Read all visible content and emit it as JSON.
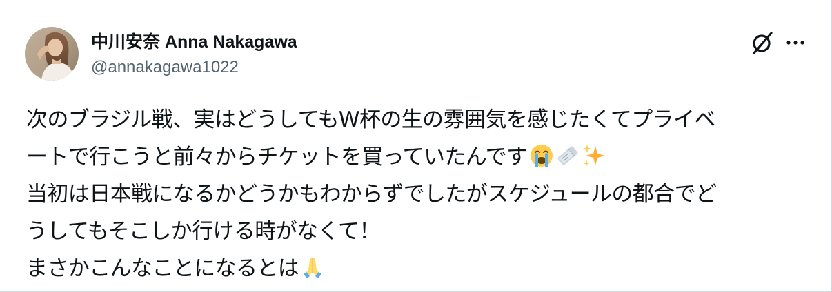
{
  "author": {
    "display_name": "中川安奈 Anna Nakagawa",
    "handle": "@annakagawa1022"
  },
  "icons": {
    "grok": "grok-slash-icon",
    "more": "more-dots-icon"
  },
  "tweet": {
    "line1": "次のブラジル戦、実はどうしてもW杯の生の雰囲気を感じたくてプライベ",
    "line2": "ートで行こうと前々からチケットを買っていたんです",
    "line2_emojis": [
      "loudly-crying-face-emoji",
      "ticket-emoji",
      "sparkles-emoji"
    ],
    "line3": "当初は日本戦になるかどうかもわからずでしたがスケジュールの都合でど",
    "line4": "うしてもそこしか行ける時がなくて！",
    "line5": "まさかこんなことになるとは",
    "line5_emojis": [
      "folded-hands-emoji"
    ]
  },
  "colors": {
    "text_primary": "#0f1419",
    "text_secondary": "#536471",
    "border": "#cfd9de",
    "background": "#ffffff"
  }
}
